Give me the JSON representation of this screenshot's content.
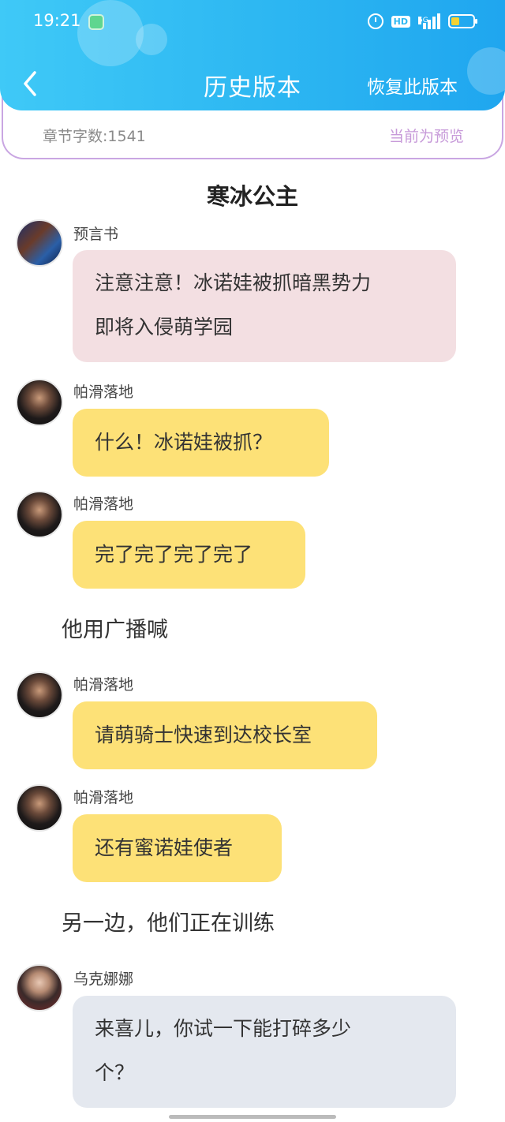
{
  "status_bar": {
    "time": "19:21",
    "icons": [
      "app-icon",
      "alarm-icon",
      "hd-icon",
      "5g-signal-icon",
      "battery-icon"
    ],
    "network": "5G",
    "hd": "HD"
  },
  "header": {
    "title": "历史版本",
    "restore_label": "恢复此版本",
    "back_icon": "chevron-left-icon"
  },
  "info": {
    "word_count": "章节字数:1541",
    "preview": "当前为预览"
  },
  "chapter": {
    "title": "寒冰公主"
  },
  "messages": [
    {
      "speaker": "预言书",
      "text_lines": [
        "注意注意！冰诺娃被抓暗黑势力",
        "即将入侵萌学园"
      ],
      "color": "#f3dfe2"
    },
    {
      "speaker": "帕滑落地",
      "text_lines": [
        "什么！冰诺娃被抓？"
      ],
      "color": "#fde177"
    },
    {
      "speaker": "帕滑落地",
      "text_lines": [
        "完了完了完了完了"
      ],
      "color": "#fde177"
    },
    {
      "speaker": "帕滑落地",
      "text_lines": [
        "请萌骑士快速到达校长室"
      ],
      "color": "#fde177"
    },
    {
      "speaker": "帕滑落地",
      "text_lines": [
        "还有蜜诺娃使者"
      ],
      "color": "#fde177"
    },
    {
      "speaker": "乌克娜娜",
      "text_lines": [
        "来喜儿，你试一下能打碎多少",
        "个？"
      ],
      "color": "#e4e8ef"
    }
  ],
  "narrations": [
    "他用广播喊",
    "另一边，他们正在训练"
  ]
}
